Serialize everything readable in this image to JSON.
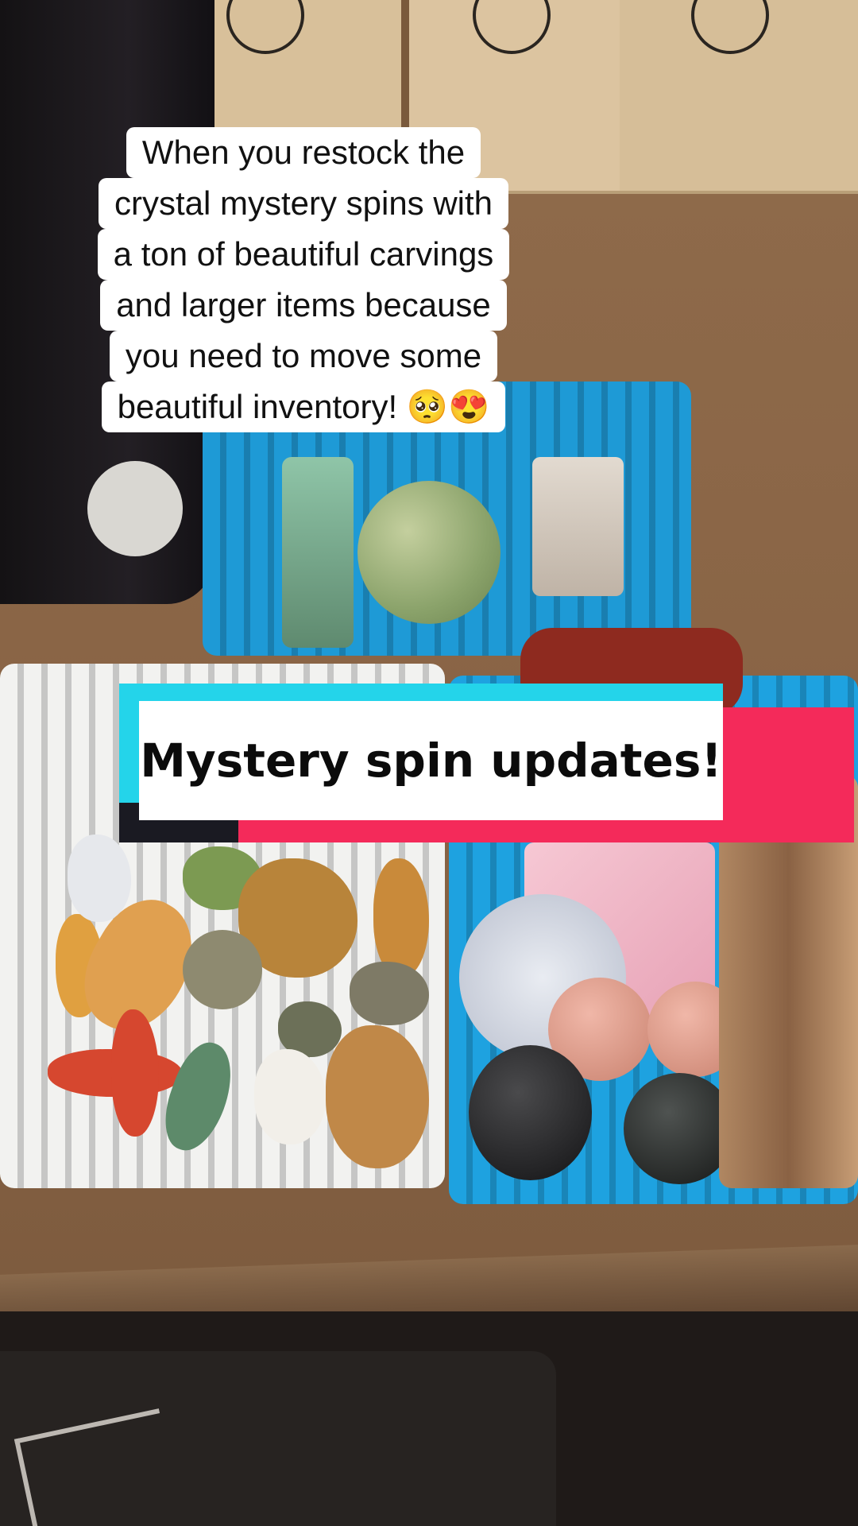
{
  "caption": {
    "lines": [
      "When you restock the",
      "crystal mystery spins with",
      "a ton of beautiful carvings",
      "and larger items because",
      "you need to move some",
      "beautiful inventory! 🥺😍"
    ]
  },
  "title_card": {
    "text": "Mystery spin updates!"
  },
  "colors": {
    "accent_cyan": "#24d4ea",
    "accent_red": "#f42a5a",
    "card_bg": "#ffffff",
    "text": "#0b0b0b"
  }
}
